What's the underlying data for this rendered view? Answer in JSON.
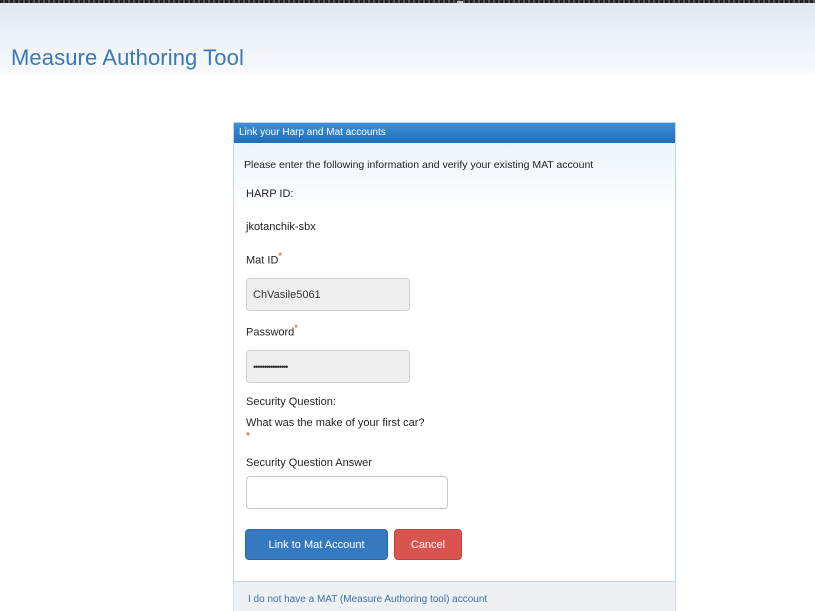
{
  "app": {
    "title": "Measure Authoring Tool"
  },
  "panel": {
    "title": "Link your Harp and Mat accounts",
    "instructions": "Please enter the following information and verify your existing MAT account",
    "harp_id_label": "HARP ID:",
    "harp_id_value": "jkotanchik-sbx",
    "mat_id_label": "Mat ID",
    "mat_id_value": "ChVasile5061",
    "password_label": "Password",
    "password_value": "••••••••••••••••",
    "security_question_label": "Security Question:",
    "security_question_text": "What was the make of your first car?",
    "required_marker": "*",
    "security_answer_label": "Security Question Answer",
    "security_answer_value": ""
  },
  "buttons": {
    "link_label": "Link to Mat Account",
    "cancel_label": "Cancel"
  },
  "footer": {
    "no_account_link": "I do not have a MAT (Measure Authoring tool) account"
  },
  "colors": {
    "brand_blue": "#3a79b5",
    "panel_header": "#1f6fb8",
    "primary_button": "#3779c0",
    "danger_button": "#d9534f",
    "required": "#d0312d"
  }
}
